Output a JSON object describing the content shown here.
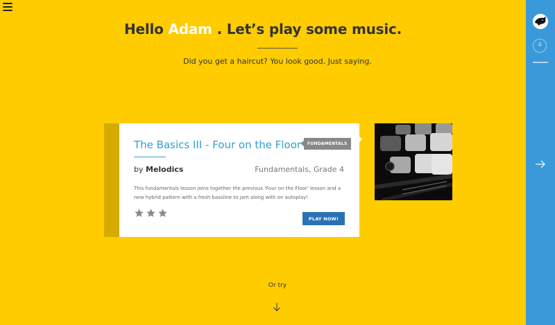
{
  "header": {
    "menu_icon": "hamburger-menu-icon",
    "greeting_prefix": "Hello",
    "user_name": "Adam",
    "greeting_suffix": ". Let’s play some music.",
    "subtitle": "Did you get a haircut? You look good. Just saying."
  },
  "lesson": {
    "title": "The Basics III - Four on the Floor",
    "badge": "FUNDAMENTALS",
    "by_prefix": "by",
    "author": "Melodics",
    "category": "Fundamentals, Grade 4",
    "description": "This fundamentals lesson joins together the previous 'Four on the Floor' lesson and a new hybrid pattern with a fresh bassline to jam along with on autoplay!",
    "stars": 3,
    "play_label": "PLAY NOW!",
    "thumbnail": "drum-pad-controller-image"
  },
  "footer": {
    "or_try": "Or try",
    "arrow_icon": "arrow-down-icon"
  },
  "sidebar": {
    "avatar_icon": "user-avatar-icon",
    "count": "4",
    "next_icon": "arrow-right-icon"
  },
  "colors": {
    "background": "#ffcc00",
    "accent_blue": "#2f9fd4",
    "sidebar": "#3a9ad9",
    "button": "#2a72b5",
    "stripe": "#d6ab00",
    "name_highlight": "#ffffff"
  }
}
